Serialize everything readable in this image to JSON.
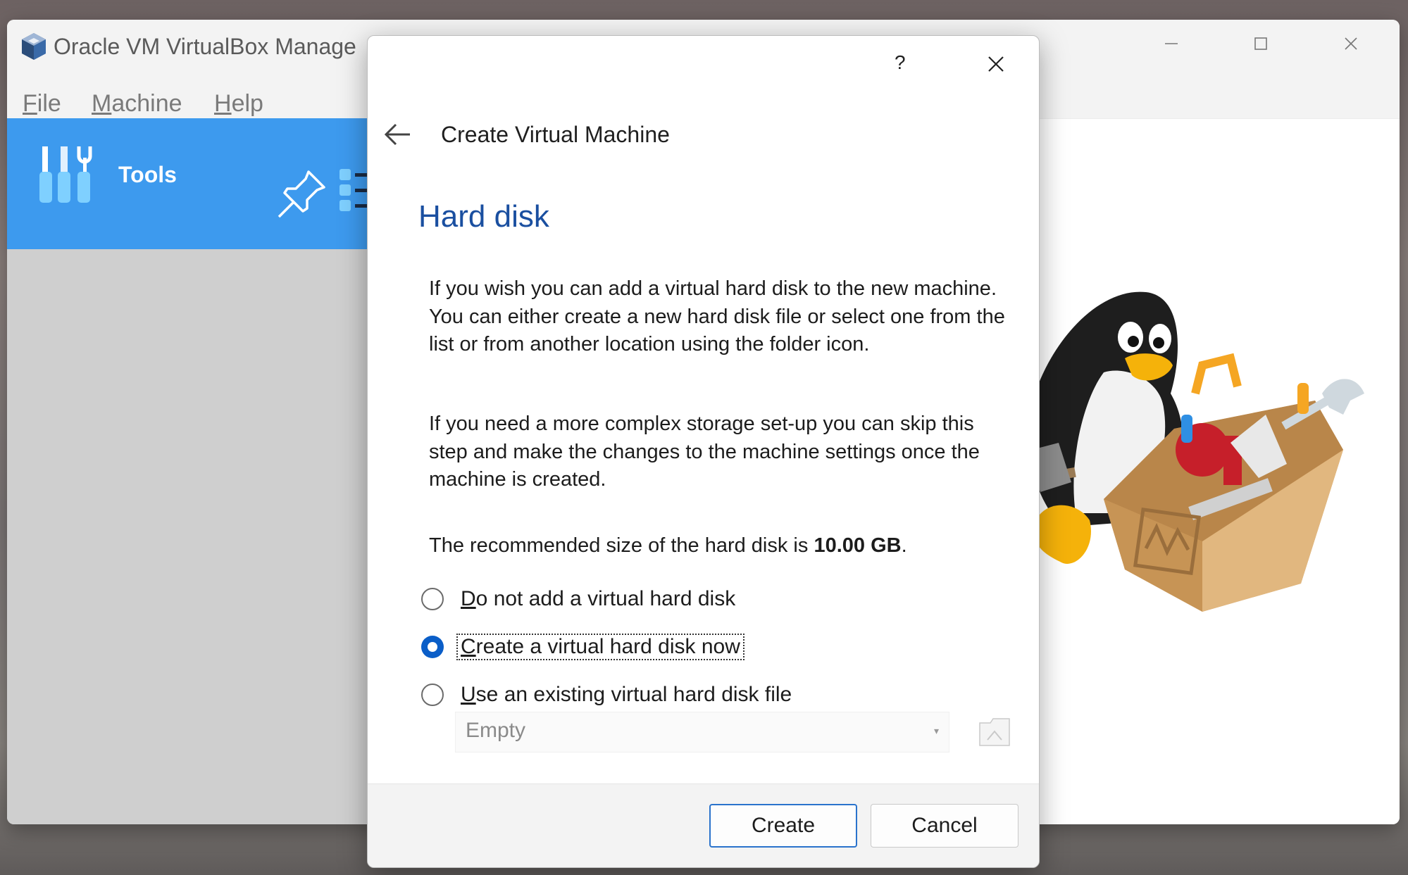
{
  "window": {
    "title": "Oracle VM VirtualBox Manage",
    "controls": [
      "minimize-icon",
      "maximize-icon",
      "close-icon"
    ]
  },
  "menu": {
    "file": {
      "accel": "F",
      "rest": "ile"
    },
    "machine": {
      "accel": "M",
      "rest": "achine"
    },
    "help": {
      "accel": "H",
      "rest": "elp"
    }
  },
  "sidebar": {
    "tools_label": "Tools",
    "icons": [
      "tools-icon",
      "pin-icon",
      "list-menu-icon"
    ]
  },
  "dialog": {
    "help_label": "?",
    "title": "Create Virtual Machine",
    "heading": "Hard disk",
    "paragraph1": "If you wish you can add a virtual hard disk to the new machine. You can either create a new hard disk file or select one from the list or from another location using the folder icon.",
    "paragraph2": "If you need a more complex storage set-up you can skip this step and make the changes to the machine settings once the machine is created.",
    "recommend_prefix": "The recommended size of the hard disk is ",
    "recommend_value": "10.00 GB",
    "recommend_suffix": ".",
    "options": [
      {
        "accel": "D",
        "rest": "o not add a virtual hard disk",
        "checked": false
      },
      {
        "accel": "C",
        "rest": "reate a virtual hard disk now",
        "checked": true
      },
      {
        "accel": "U",
        "rest": "se an existing virtual hard disk file",
        "checked": false
      }
    ],
    "disk_combo_value": "Empty",
    "create_button": "Create",
    "cancel_button": "Cancel"
  },
  "colors": {
    "accent": "#3d9aee",
    "heading": "#1a4fa0",
    "radio_checked": "#0a5ec8"
  }
}
